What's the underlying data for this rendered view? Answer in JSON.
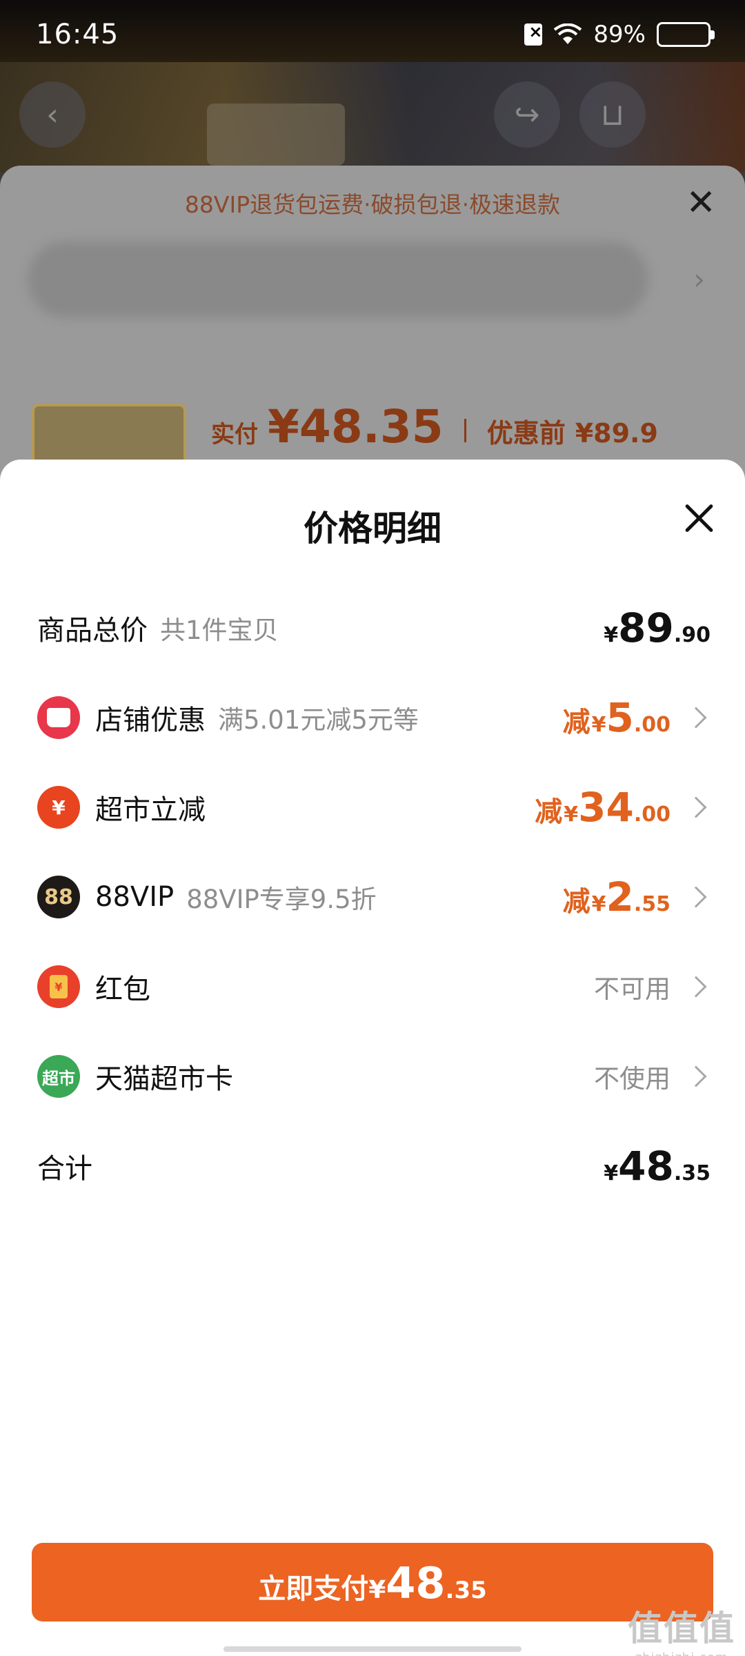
{
  "status_bar": {
    "time": "16:45",
    "battery": "89%",
    "battery_level": 0.89
  },
  "background": {
    "banner": "88VIP退货包运费·破损包退·极速退款",
    "price_label": "实付",
    "price": "¥48.35",
    "original_label": "优惠前",
    "original_price": "¥89.9"
  },
  "sheet": {
    "title": "价格明细",
    "rows": [
      {
        "label": "商品总价",
        "sub": "共1件宝贝",
        "prefix": "",
        "yen": "¥",
        "int": "89",
        "dec": ".90"
      },
      {
        "label": "店铺优惠",
        "sub": "满5.01元减5元等",
        "prefix": "减",
        "yen": "¥",
        "int": "5",
        "dec": ".00",
        "icon": "store-icon"
      },
      {
        "label": "超市立减",
        "sub": "",
        "prefix": "减",
        "yen": "¥",
        "int": "34",
        "dec": ".00",
        "icon": "market-discount-icon",
        "icon_text": "¥"
      },
      {
        "label": "88VIP",
        "sub": "88VIP专享9.5折",
        "prefix": "减",
        "yen": "¥",
        "int": "2",
        "dec": ".55",
        "icon": "vip88-icon",
        "icon_text": "88"
      },
      {
        "label": "红包",
        "status": "不可用",
        "icon": "red-packet-icon",
        "icon_text": "¥"
      },
      {
        "label": "天猫超市卡",
        "status": "不使用",
        "icon": "tmall-card-icon",
        "icon_text": "超市"
      },
      {
        "label": "合计",
        "yen": "¥",
        "int": "48",
        "dec": ".35"
      }
    ]
  },
  "pay_button": {
    "label": "立即支付",
    "yen": "¥",
    "int": "48",
    "dec": ".35"
  },
  "watermark": {
    "main": "值值值",
    "sub": "zhizhizhi.com"
  },
  "colors": {
    "accent": "#ec6322",
    "discount": "#e0621e"
  }
}
